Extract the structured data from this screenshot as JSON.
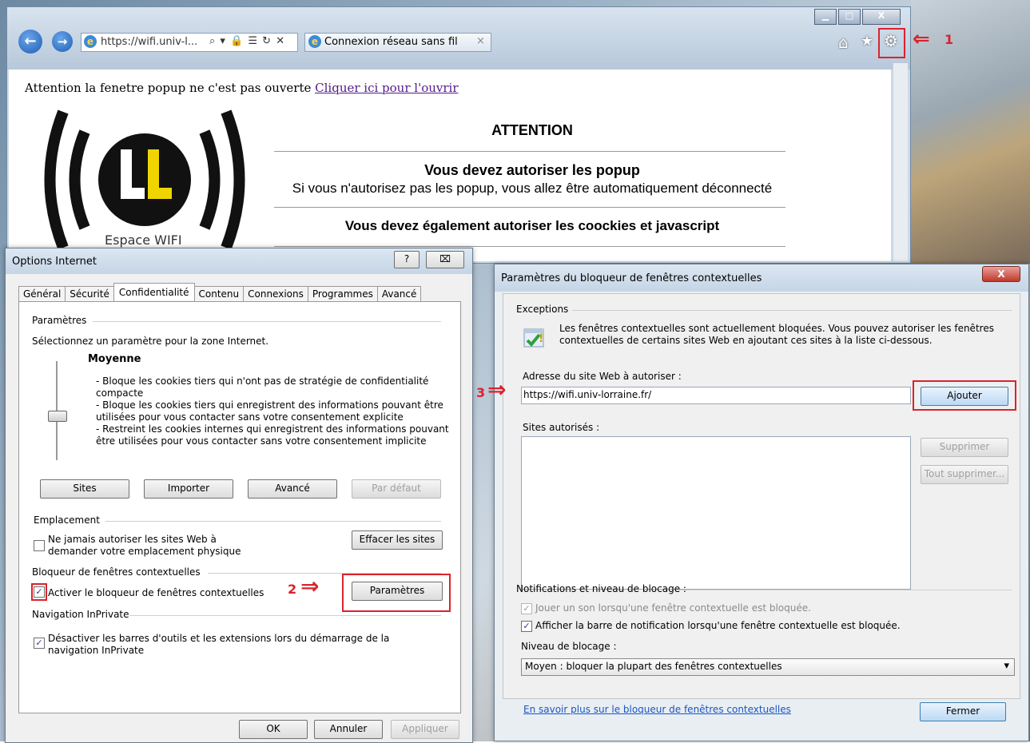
{
  "browser": {
    "url": "https://wifi.univ-l...",
    "tab_title": "Connexion réseau sans fil",
    "back_glyph": "←",
    "forward_glyph": "→",
    "addr_icons": "⌕ ▾ 🔒 ☰ ↻ ✕",
    "tab_close": "×",
    "min_glyph": "▁",
    "max_glyph": "□",
    "close_glyph": "X",
    "home_glyph": "⌂",
    "fav_glyph": "★",
    "tools_glyph": "⚙",
    "marker_1": "1"
  },
  "page": {
    "popup_warning": "Attention la fenetre popup ne c'est pas ouverte",
    "popup_link": "Cliquer ici pour l'ouvrir",
    "logo_caption": "Espace WIFI",
    "attention": "ATTENTION",
    "popup_title": "Vous devez autoriser les popup",
    "popup_sub": "Si vous n'autorisez pas les popup, vous allez être automatiquement déconnecté",
    "cookies": "Vous devez également autoriser les coockies et javascript"
  },
  "options": {
    "title": "Options Internet",
    "help_glyph": "?",
    "close_glyph": "⌧",
    "tabs": [
      "Général",
      "Sécurité",
      "Confidentialité",
      "Contenu",
      "Connexions",
      "Programmes",
      "Avancé"
    ],
    "settings_group": "Paramètres",
    "zone_text": "Sélectionnez un paramètre pour la zone Internet.",
    "level": "Moyenne",
    "desc1": "- Bloque les cookies tiers qui n'ont pas de stratégie de confidentialité",
    "desc1b": "compacte",
    "desc2": "- Bloque les cookies tiers qui enregistrent des informations pouvant être",
    "desc2b": "utilisées pour vous contacter sans votre consentement explicite",
    "desc3": "- Restreint les cookies internes qui enregistrent des informations pouvant",
    "desc3b": "être utilisées pour vous contacter sans votre consentement implicite",
    "btn_sites": "Sites",
    "btn_import": "Importer",
    "btn_advanced": "Avancé",
    "btn_default": "Par défaut",
    "location_group": "Emplacement",
    "location_chk1": "Ne jamais autoriser les sites Web à",
    "location_chk2": "demander votre emplacement physique",
    "btn_clear_sites": "Effacer les sites",
    "popup_group": "Bloqueur de fenêtres contextuelles",
    "popup_chk": "Activer le bloqueur de fenêtres contextuelles",
    "btn_settings": "Paramètres",
    "marker_2": "2",
    "inprivate_group": "Navigation InPrivate",
    "inprivate_chk1": "Désactiver les barres d'outils et les extensions lors du démarrage de la",
    "inprivate_chk2": "navigation InPrivate",
    "btn_ok": "OK",
    "btn_cancel": "Annuler",
    "btn_apply": "Appliquer",
    "check_glyph": "✓"
  },
  "popup_blocker": {
    "title": "Paramètres du bloqueur de fenêtres contextuelles",
    "close_glyph": "X",
    "exceptions_group": "Exceptions",
    "info1": "Les fenêtres contextuelles sont actuellement bloquées.  Vous pouvez autoriser les fenêtres",
    "info2": "contextuelles de certains sites Web en ajoutant ces sites à la liste ci-dessous.",
    "address_label": "Adresse du site Web à autoriser :",
    "address_value": "https://wifi.univ-lorraine.fr/",
    "btn_add": "Ajouter",
    "marker_3": "3",
    "allowed_label": "Sites autorisés :",
    "btn_remove": "Supprimer",
    "btn_remove_all": "Tout supprimer...",
    "notif_group": "Notifications et niveau de blocage :",
    "chk_sound": "Jouer un son lorsqu'une fenêtre contextuelle est bloquée.",
    "chk_bar": "Afficher la barre de notification lorsqu'une fenêtre contextuelle est bloquée.",
    "level_label": "Niveau de blocage :",
    "level_value": "Moyen : bloquer la plupart des fenêtres contextuelles",
    "learn_more": "En savoir plus sur le bloqueur de fenêtres contextuelles",
    "btn_close": "Fermer",
    "check_glyph": "✓",
    "dropdown_glyph": "▾"
  }
}
